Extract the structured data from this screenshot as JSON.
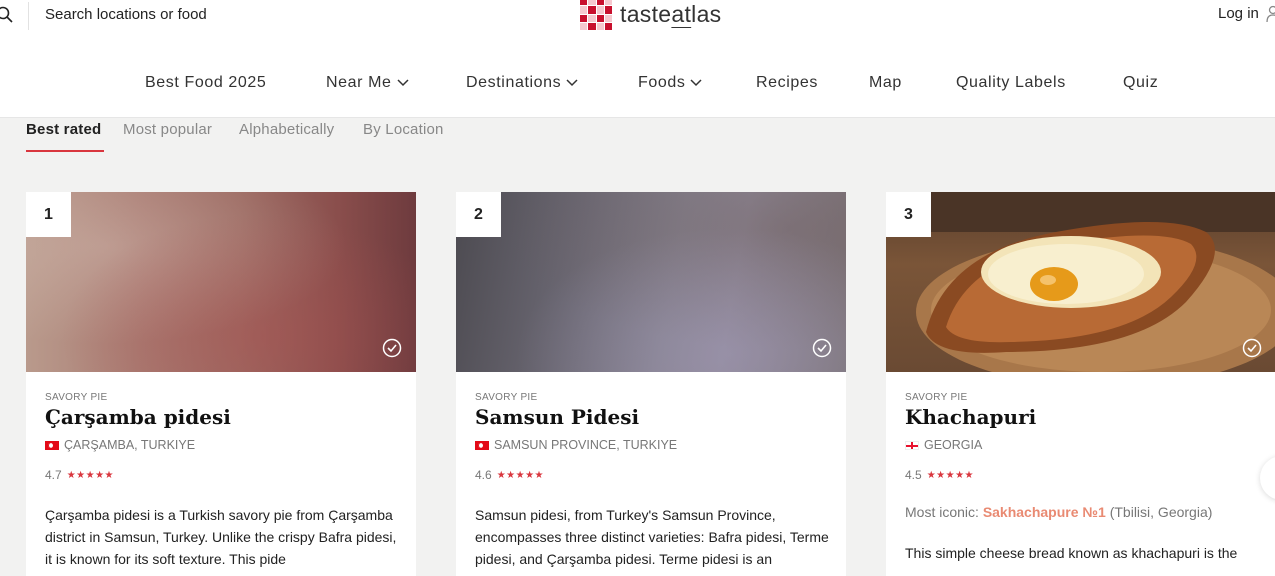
{
  "header": {
    "search_placeholder": "Search locations or food",
    "logo": {
      "prefix": "taste",
      "underlined": "at",
      "suffix": "las"
    },
    "login_label": "Log in",
    "brand_color": "#c8102e"
  },
  "nav": {
    "items": [
      {
        "label": "Best Food 2025"
      },
      {
        "label": "Near Me",
        "dropdown": true
      },
      {
        "label": "Destinations",
        "dropdown": true
      },
      {
        "label": "Foods",
        "dropdown": true
      },
      {
        "label": "Recipes"
      },
      {
        "label": "Map"
      },
      {
        "label": "Quality Labels"
      },
      {
        "label": "Quiz"
      }
    ]
  },
  "sort_tabs": {
    "items": [
      "Best rated",
      "Most popular",
      "Alphabetically",
      "By Location"
    ],
    "active": "Best rated"
  },
  "cards": [
    {
      "rank": "1",
      "category": "SAVORY PIE",
      "title": "Çarşamba pidesi",
      "origin": "ÇARŞAMBA, TURKIYE",
      "flag": "turkey-flag",
      "rating": "4.7",
      "stars": "★★★★★",
      "description": "Çarşamba pidesi is a Turkish savory pie from Çarşamba district in Samsun, Turkey. Unlike the crispy Bafra pidesi, it is known for its soft texture. This pide"
    },
    {
      "rank": "2",
      "category": "SAVORY PIE",
      "title": "Samsun Pidesi",
      "origin": "SAMSUN PROVINCE, TURKIYE",
      "flag": "turkey-flag",
      "rating": "4.6",
      "stars": "★★★★★",
      "description": "Samsun pidesi, from Turkey's Samsun Province, encompasses three distinct varieties: Bafra pidesi, Terme pidesi, and Çarşamba pidesi. Terme pidesi is an"
    },
    {
      "rank": "3",
      "category": "SAVORY PIE",
      "title": "Khachapuri",
      "origin": "GEORGIA",
      "flag": "georgia-flag",
      "rating": "4.5",
      "stars": "★★★★★",
      "iconic_label": "Most iconic:",
      "iconic_place": "Sakhachapure №1",
      "iconic_location": "(Tbilisi, Georgia)",
      "description": "This simple cheese bread known as khachapuri is the"
    }
  ],
  "colors": {
    "accent": "#d9363e",
    "page_bg": "#f2f2f1",
    "iconic_highlight": "#e98a72"
  }
}
